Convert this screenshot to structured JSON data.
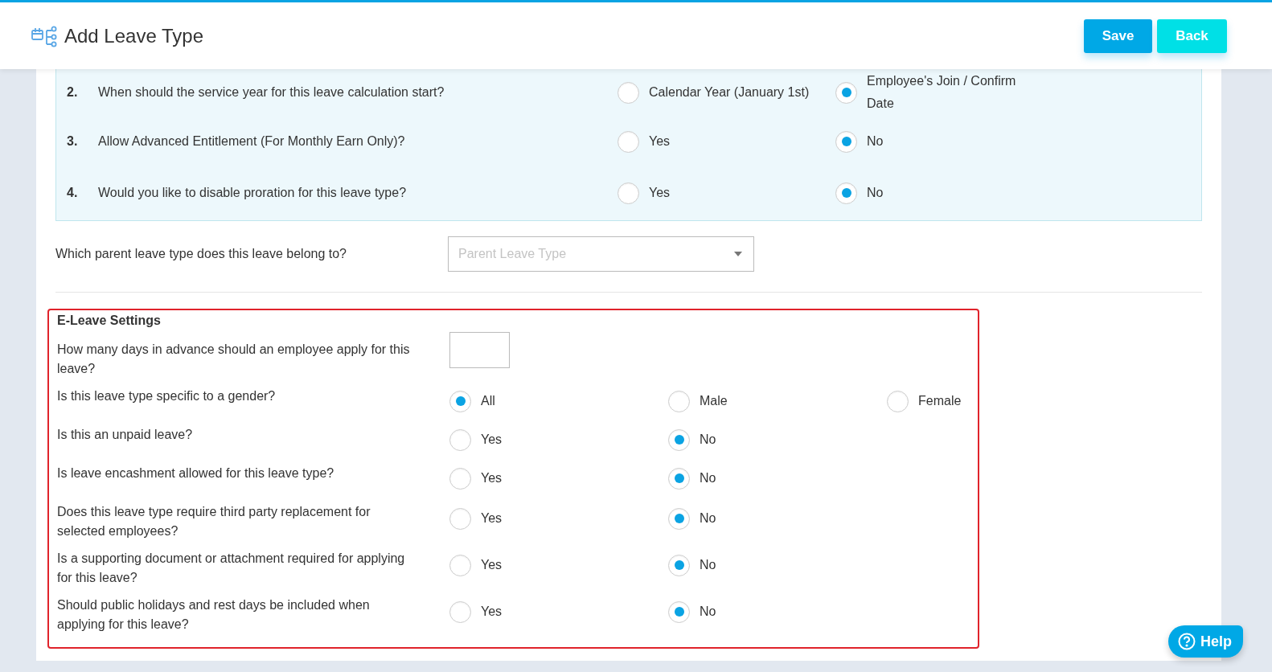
{
  "header": {
    "title": "Add Leave Type",
    "buttons": [
      {
        "label": "Save",
        "kind": "primary"
      },
      {
        "label": "Back",
        "kind": "secondary"
      }
    ]
  },
  "numbered_questions": [
    {
      "number": "2.",
      "question": "When should the service year for this leave calculation start?",
      "options": [
        {
          "label": "Calendar Year (January 1st)",
          "selected": false
        },
        {
          "label": "Employee's Join / Confirm Date",
          "selected": true
        }
      ]
    },
    {
      "number": "3.",
      "question": "Allow Advanced Entitlement (For Monthly Earn Only)?",
      "options": [
        {
          "label": "Yes",
          "selected": false
        },
        {
          "label": "No",
          "selected": true
        }
      ]
    },
    {
      "number": "4.",
      "question": "Would you like to disable proration for this leave type?",
      "options": [
        {
          "label": "Yes",
          "selected": false
        },
        {
          "label": "No",
          "selected": true
        }
      ]
    }
  ],
  "parent_leave": {
    "label": "Which parent leave type does this leave belong to?",
    "placeholder": "Parent Leave Type"
  },
  "e_leave": {
    "title": "E-Leave Settings",
    "questions": [
      {
        "kind": "text",
        "question": "How many days in advance should an employee apply for this leave?"
      },
      {
        "kind": "radio",
        "question": "Is this leave type specific to a gender?",
        "options": [
          {
            "label": "All",
            "selected": true
          },
          {
            "label": "Male",
            "selected": false
          },
          {
            "label": "Female",
            "selected": false
          }
        ]
      },
      {
        "kind": "radio",
        "question": "Is this an unpaid leave?",
        "options": [
          {
            "label": "Yes",
            "selected": false
          },
          {
            "label": "No",
            "selected": true
          }
        ]
      },
      {
        "kind": "radio",
        "question": "Is leave encashment allowed for this leave type?",
        "options": [
          {
            "label": "Yes",
            "selected": false
          },
          {
            "label": "No",
            "selected": true
          }
        ]
      },
      {
        "kind": "radio",
        "question": "Does this leave type require third party replacement for selected employees?",
        "options": [
          {
            "label": "Yes",
            "selected": false
          },
          {
            "label": "No",
            "selected": true
          }
        ]
      },
      {
        "kind": "radio",
        "question": "Is a supporting document or attachment required for applying for this leave?",
        "options": [
          {
            "label": "Yes",
            "selected": false
          },
          {
            "label": "No",
            "selected": true
          }
        ]
      },
      {
        "kind": "radio",
        "question": "Should public holidays and rest days be included when applying for this leave?",
        "options": [
          {
            "label": "Yes",
            "selected": false
          },
          {
            "label": "No",
            "selected": true
          }
        ]
      }
    ]
  },
  "help": {
    "label": "Help"
  }
}
